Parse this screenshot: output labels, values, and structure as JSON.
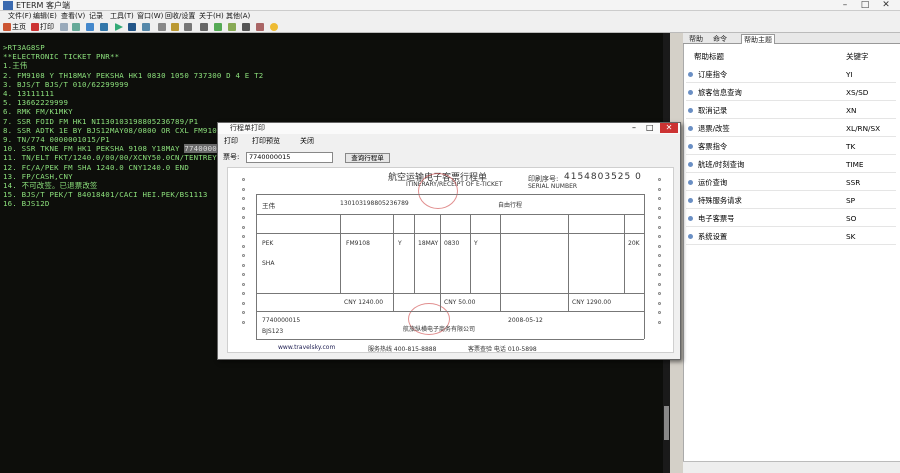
{
  "app": {
    "title": "ETERM 客户端",
    "min": "–",
    "max": "□",
    "close": "✕"
  },
  "menu": [
    "文件(F)",
    "编辑(E)",
    "查看(V)",
    "记录",
    "工具(T)",
    "窗口(W)",
    "回收/设置",
    "关于(H)",
    "其他(A)"
  ],
  "toolbar": {
    "first": "主页",
    "second": "打印"
  },
  "terminal": {
    "lines": [
      ">RT3AG8SP",
      "**ELECTRONIC TICKET PNR**",
      " 1.王伟",
      " 2. FM9108 Y TH18MAY PEKSHA HK1 0830 1050 737300 D 4 E T2",
      " 3. BJS/T BJS/T 010/62299999",
      " 4. 13111111",
      " 5. 13662229999",
      " 6. RMK FM/K1MKY",
      " 7. SSR FOID FM HK1 NI130103198805236789/P1",
      " 8. SSR ADTK 1E BY BJS12MAY08/0800 OR CXL FM9108 Y18MAY",
      " 9. TN/774 0000001015/P1",
      "10. SSR TKNE FM HK1 PEKSHA 9108 Y18MAY",
      "11. TN/ELT FKT/1240.0/00/00/XCNY50.0CN/TENTREY2Q/ACNY",
      "12. FC/A/PEK FM SHA 1240.0 CNY1240.0 END",
      "13. FP/CASH,CNY",
      "14. 不可改签。已退票改签",
      "15. BJS/T PEK/T 84018401/CACI HEI.PEK/BS1113",
      "16. BJS12D"
    ],
    "highlight": "77400000015/P1"
  },
  "right_panel": {
    "tabs": [
      "帮助",
      "命令",
      "帮助主题"
    ],
    "header": {
      "name": "帮助标题",
      "keyword": "关键字"
    },
    "items": [
      {
        "name": "订座指令",
        "key": "YI"
      },
      {
        "name": "旅客信息查询",
        "key": "XS/SD"
      },
      {
        "name": "取消记录",
        "key": "XN"
      },
      {
        "name": "退票/改签",
        "key": "XL/RN/SX"
      },
      {
        "name": "客票指令",
        "key": "TK"
      },
      {
        "name": "航班/时刻查询",
        "key": "TIME"
      },
      {
        "name": "运价查询",
        "key": "SSR"
      },
      {
        "name": "特殊服务请求",
        "key": "SP"
      },
      {
        "name": "电子客票号",
        "key": "SO"
      },
      {
        "name": "系统设置",
        "key": "SK"
      }
    ]
  },
  "dialog": {
    "title": "行程单打印",
    "toolbar": [
      "打印",
      "打印预览",
      "关闭"
    ],
    "form_label": "票号:",
    "ticket_value": "7740000015",
    "query_btn": "查询行程单",
    "itinerary": {
      "heading": "航空运输电子客票行程单",
      "heading_en": "ITINERARY/RECEIPT OF E-TICKET",
      "serial_label": "印刷序号:",
      "serial_en": "SERIAL NUMBER",
      "serial": "4154803525 0",
      "passenger": "王伟",
      "id_no": "130103198805236789",
      "route_label": "自由行程",
      "from": "PEK",
      "to": "SHA",
      "flight": "FM9108",
      "class": "Y",
      "date": "18MAY",
      "time": "0830",
      "fare_basis": "Y",
      "baggage": "20K",
      "fare": "CNY 1240.00",
      "tax": "CNY 50.00",
      "total": "CNY 1290.00",
      "ticket_no": "7740000015",
      "issuer": "航旅纵横电子商务有限公司",
      "issue_date": "2008-05-12",
      "website": "www.travelsky.com",
      "hotline": "服务热线 400-815-8888",
      "agent_code": "BJS123",
      "footer_note": "客票查验 电话 010-5898"
    }
  }
}
